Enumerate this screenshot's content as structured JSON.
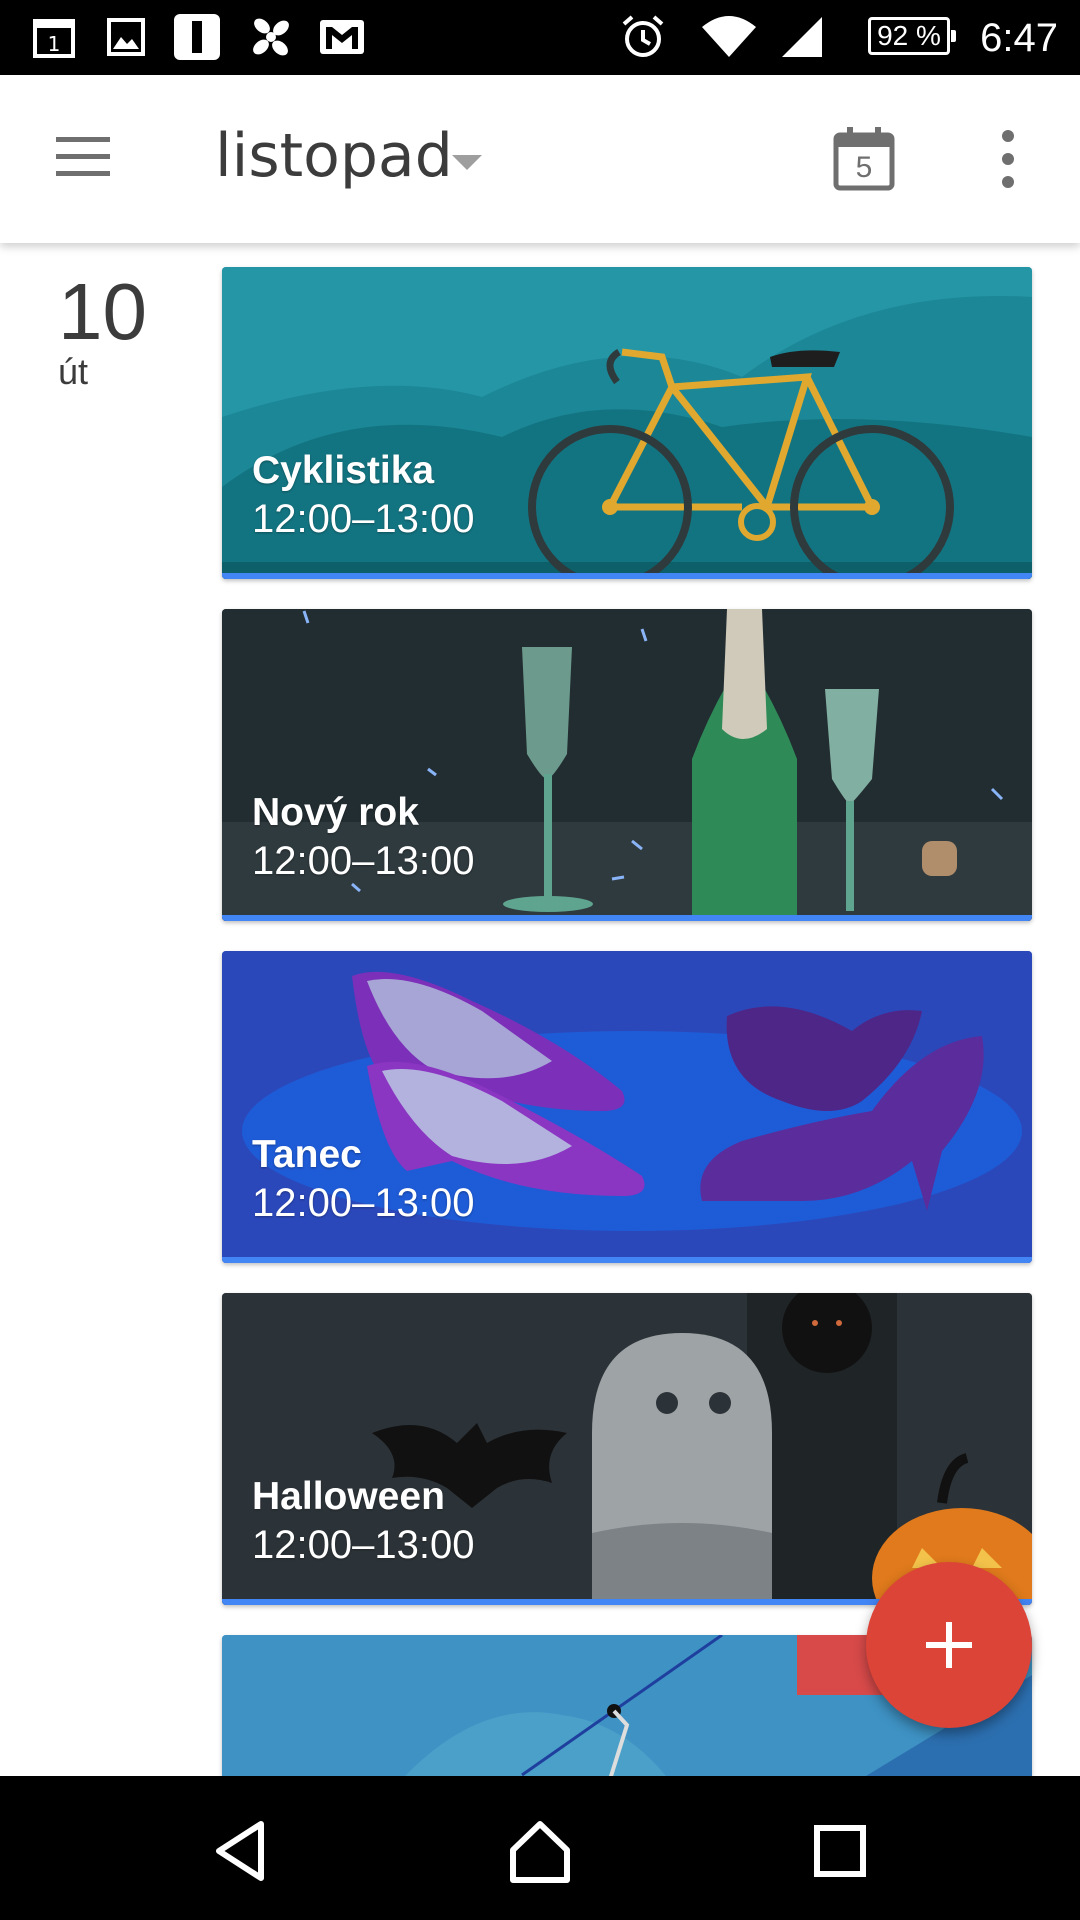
{
  "status_bar": {
    "time": "6:47",
    "battery": "92 %",
    "notification_icons": [
      "calendar-1-icon",
      "image-icon",
      "app-icon",
      "fan-icon",
      "gmail-icon"
    ],
    "system_icons": [
      "alarm-icon",
      "wifi-icon",
      "signal-icon",
      "battery-icon"
    ]
  },
  "app_bar": {
    "month": "listopad",
    "today_date": "5"
  },
  "day": {
    "number": "10",
    "weekday": "út"
  },
  "events": [
    {
      "title": "Cyklistika",
      "time": "12:00–13:00",
      "theme": "cycling",
      "color": "#1f8fa0"
    },
    {
      "title": "Nový rok",
      "time": "12:00–13:00",
      "theme": "new-year",
      "color": "#263238"
    },
    {
      "title": "Tanec",
      "time": "12:00–13:00",
      "theme": "dance",
      "color": "#2a47b8"
    },
    {
      "title": "Halloween",
      "time": "12:00–13:00",
      "theme": "halloween",
      "color": "#2c3338"
    }
  ],
  "colors": {
    "accent_underline": "#4285f4",
    "fab": "#db4437"
  }
}
